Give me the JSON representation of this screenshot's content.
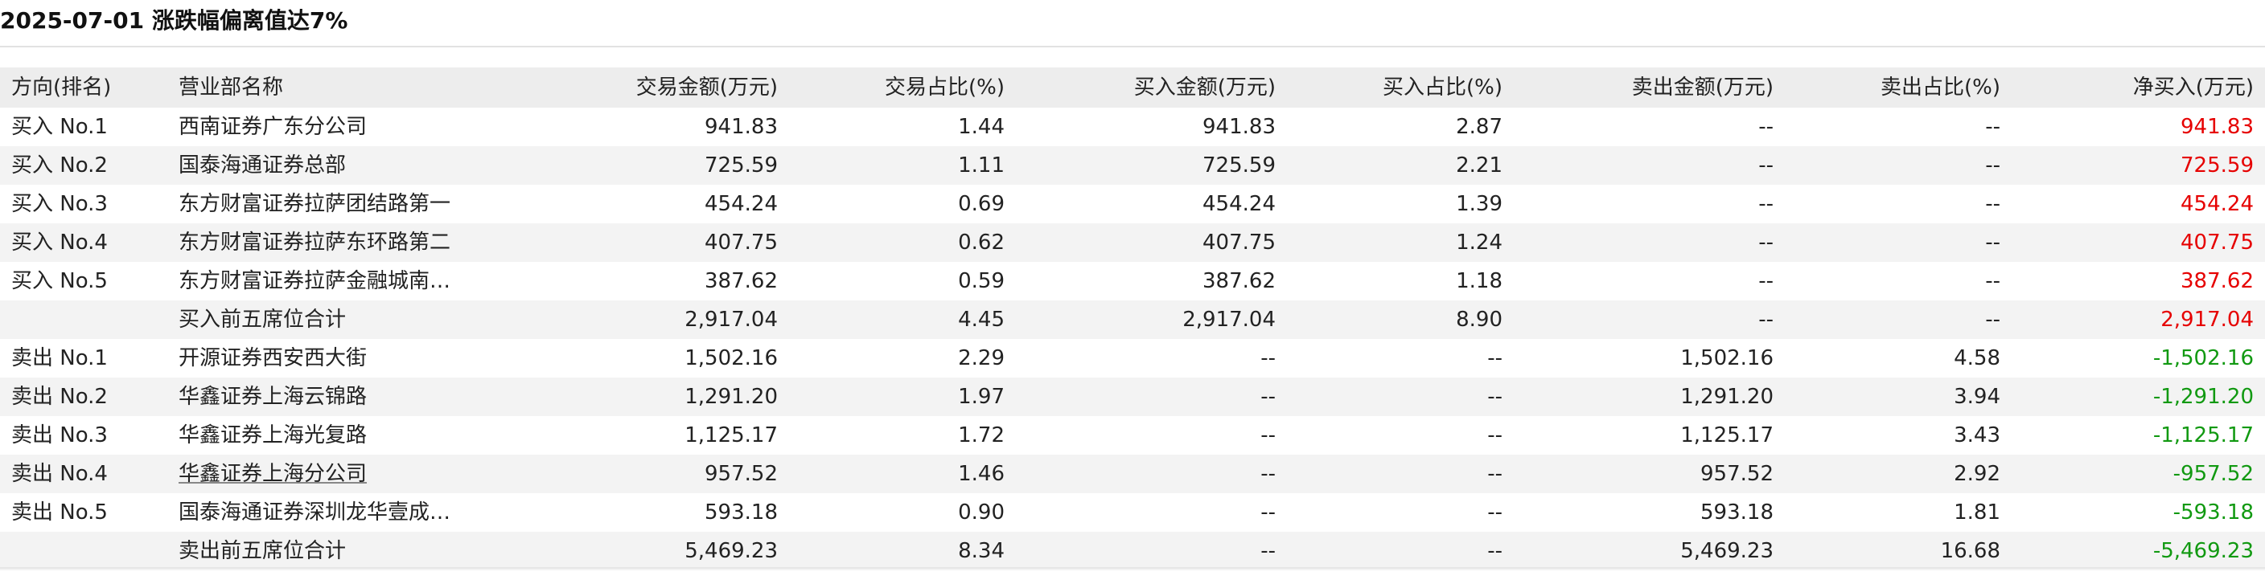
{
  "page_title": "2025-07-01 涨跌幅偏离值达7%",
  "columns": [
    "方向(排名)",
    "营业部名称",
    "交易金额(万元)",
    "交易占比(%)",
    "买入金额(万元)",
    "买入占比(%)",
    "卖出金额(万元)",
    "卖出占比(%)",
    "净买入(万元)"
  ],
  "colors": {
    "positive": "#e60000",
    "negative": "#119911",
    "header_bg": "#ededed",
    "alt_row_bg": "#f3f3f3"
  },
  "rows": [
    {
      "rank": "买入 No.1",
      "branch": "西南证券广东分公司",
      "trade_amount": "941.83",
      "trade_pct": "1.44",
      "buy_amount": "941.83",
      "buy_pct": "2.87",
      "sell_amount": "--",
      "sell_pct": "--",
      "net_buy": "941.83",
      "net_sign": "positive"
    },
    {
      "rank": "买入 No.2",
      "branch": "国泰海通证券总部",
      "trade_amount": "725.59",
      "trade_pct": "1.11",
      "buy_amount": "725.59",
      "buy_pct": "2.21",
      "sell_amount": "--",
      "sell_pct": "--",
      "net_buy": "725.59",
      "net_sign": "positive"
    },
    {
      "rank": "买入 No.3",
      "branch": "东方财富证券拉萨团结路第一",
      "trade_amount": "454.24",
      "trade_pct": "0.69",
      "buy_amount": "454.24",
      "buy_pct": "1.39",
      "sell_amount": "--",
      "sell_pct": "--",
      "net_buy": "454.24",
      "net_sign": "positive"
    },
    {
      "rank": "买入 No.4",
      "branch": "东方财富证券拉萨东环路第二",
      "trade_amount": "407.75",
      "trade_pct": "0.62",
      "buy_amount": "407.75",
      "buy_pct": "1.24",
      "sell_amount": "--",
      "sell_pct": "--",
      "net_buy": "407.75",
      "net_sign": "positive"
    },
    {
      "rank": "买入 No.5",
      "branch": "东方财富证券拉萨金融城南…",
      "trade_amount": "387.62",
      "trade_pct": "0.59",
      "buy_amount": "387.62",
      "buy_pct": "1.18",
      "sell_amount": "--",
      "sell_pct": "--",
      "net_buy": "387.62",
      "net_sign": "positive"
    },
    {
      "rank": "",
      "branch": "买入前五席位合计",
      "trade_amount": "2,917.04",
      "trade_pct": "4.45",
      "buy_amount": "2,917.04",
      "buy_pct": "8.90",
      "sell_amount": "--",
      "sell_pct": "--",
      "net_buy": "2,917.04",
      "net_sign": "positive"
    },
    {
      "rank": "卖出 No.1",
      "branch": "开源证券西安西大街",
      "trade_amount": "1,502.16",
      "trade_pct": "2.29",
      "buy_amount": "--",
      "buy_pct": "--",
      "sell_amount": "1,502.16",
      "sell_pct": "4.58",
      "net_buy": "-1,502.16",
      "net_sign": "negative"
    },
    {
      "rank": "卖出 No.2",
      "branch": "华鑫证券上海云锦路",
      "trade_amount": "1,291.20",
      "trade_pct": "1.97",
      "buy_amount": "--",
      "buy_pct": "--",
      "sell_amount": "1,291.20",
      "sell_pct": "3.94",
      "net_buy": "-1,291.20",
      "net_sign": "negative"
    },
    {
      "rank": "卖出 No.3",
      "branch": "华鑫证券上海光复路",
      "trade_amount": "1,125.17",
      "trade_pct": "1.72",
      "buy_amount": "--",
      "buy_pct": "--",
      "sell_amount": "1,125.17",
      "sell_pct": "3.43",
      "net_buy": "-1,125.17",
      "net_sign": "negative"
    },
    {
      "rank": "卖出 No.4",
      "branch": "华鑫证券上海分公司",
      "trade_amount": "957.52",
      "trade_pct": "1.46",
      "buy_amount": "--",
      "buy_pct": "--",
      "sell_amount": "957.52",
      "sell_pct": "2.92",
      "net_buy": "-957.52",
      "net_sign": "negative",
      "branch_underlined": true
    },
    {
      "rank": "卖出 No.5",
      "branch": "国泰海通证券深圳龙华壹成…",
      "trade_amount": "593.18",
      "trade_pct": "0.90",
      "buy_amount": "--",
      "buy_pct": "--",
      "sell_amount": "593.18",
      "sell_pct": "1.81",
      "net_buy": "-593.18",
      "net_sign": "negative"
    },
    {
      "rank": "",
      "branch": "卖出前五席位合计",
      "trade_amount": "5,469.23",
      "trade_pct": "8.34",
      "buy_amount": "--",
      "buy_pct": "--",
      "sell_amount": "5,469.23",
      "sell_pct": "16.68",
      "net_buy": "-5,469.23",
      "net_sign": "negative"
    }
  ]
}
